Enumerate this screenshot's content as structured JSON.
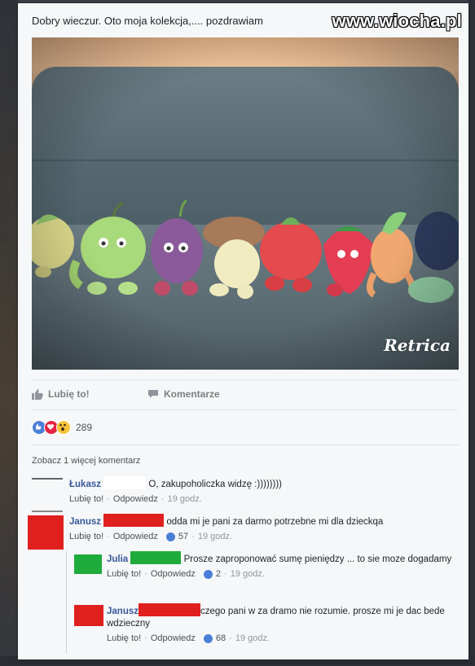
{
  "post": {
    "text": "Dobry wieczur. Oto moja kolekcja,.... pozdrawiam",
    "watermark": "www.wiocha.pl",
    "photo_overlay": "Retrica"
  },
  "actions": {
    "like_label": "Lubię to!",
    "comment_label": "Komentarze"
  },
  "reactions": {
    "count": "289"
  },
  "comments_section": {
    "view_more": "Zobacz 1 więcej komentarz",
    "items": [
      {
        "name": "Łukasz",
        "text": "O, zakupoholiczka widzę :))))))))",
        "like": "Lubię to!",
        "sep": "·",
        "reply": "Odpowiedz",
        "time": "19 godz.",
        "likes": ""
      },
      {
        "name": "Janusz",
        "text": "odda mi je pani za darmo potrzebne mi dla dzieckqa",
        "like": "Lubię to!",
        "sep": "·",
        "reply": "Odpowiedz",
        "time": "19 godz.",
        "likes": "57"
      },
      {
        "name": "Julia",
        "text": "Prosze zaproponować sumę pieniędzy ... to sie moze dogadamy",
        "like": "Lubię to!",
        "sep": "·",
        "reply": "Odpowiedz",
        "time": "19 godz.",
        "likes": "2"
      },
      {
        "name": "Janusz",
        "text": "czego pani w za dramo nie rozumie. prosze mi je dac bede wdzieczny",
        "like": "Lubię to!",
        "sep": "·",
        "reply": "Odpowiedz",
        "time": "19 godz.",
        "likes": "68"
      }
    ]
  },
  "colors": {
    "fb_blue": "#365899",
    "redaction_red": "#e0201f",
    "redaction_green": "#1faa3c",
    "like_blue": "#4a7fd8"
  }
}
